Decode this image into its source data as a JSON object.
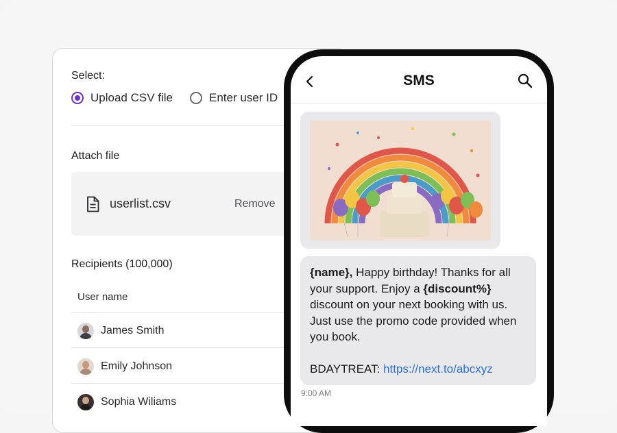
{
  "upload": {
    "select_label": "Select:",
    "options": [
      {
        "label": "Upload CSV file",
        "selected": true
      },
      {
        "label": "Enter user ID",
        "selected": false
      }
    ],
    "attach_title": "Attach file",
    "file_name": "userlist.csv",
    "remove_label": "Remove"
  },
  "recipients": {
    "title": "Recipients (100,000)",
    "column_header": "User name",
    "users": [
      {
        "name": "James Smith"
      },
      {
        "name": "Emily Johnson"
      },
      {
        "name": "Sophia Wiliams"
      }
    ]
  },
  "sms": {
    "title": "SMS",
    "message": {
      "name_var": "{name},",
      "part1": " Happy birthday! Thanks for all your support. Enjoy a ",
      "discount_var": "{discount%}",
      "part2": " discount on your next booking with us. Just use the promo code provided when you book.",
      "promo_prefix": "BDAYTREAT: ",
      "link": "https://next.to/abcxyz"
    },
    "timestamp": "9:00 AM"
  },
  "colors": {
    "accent": "#6a32c9",
    "link": "#2a6fd6",
    "bubble": "#e9e9eb"
  },
  "icons": [
    "radio-checked",
    "radio-unchecked",
    "file-icon",
    "back-chevron-icon",
    "search-icon"
  ]
}
